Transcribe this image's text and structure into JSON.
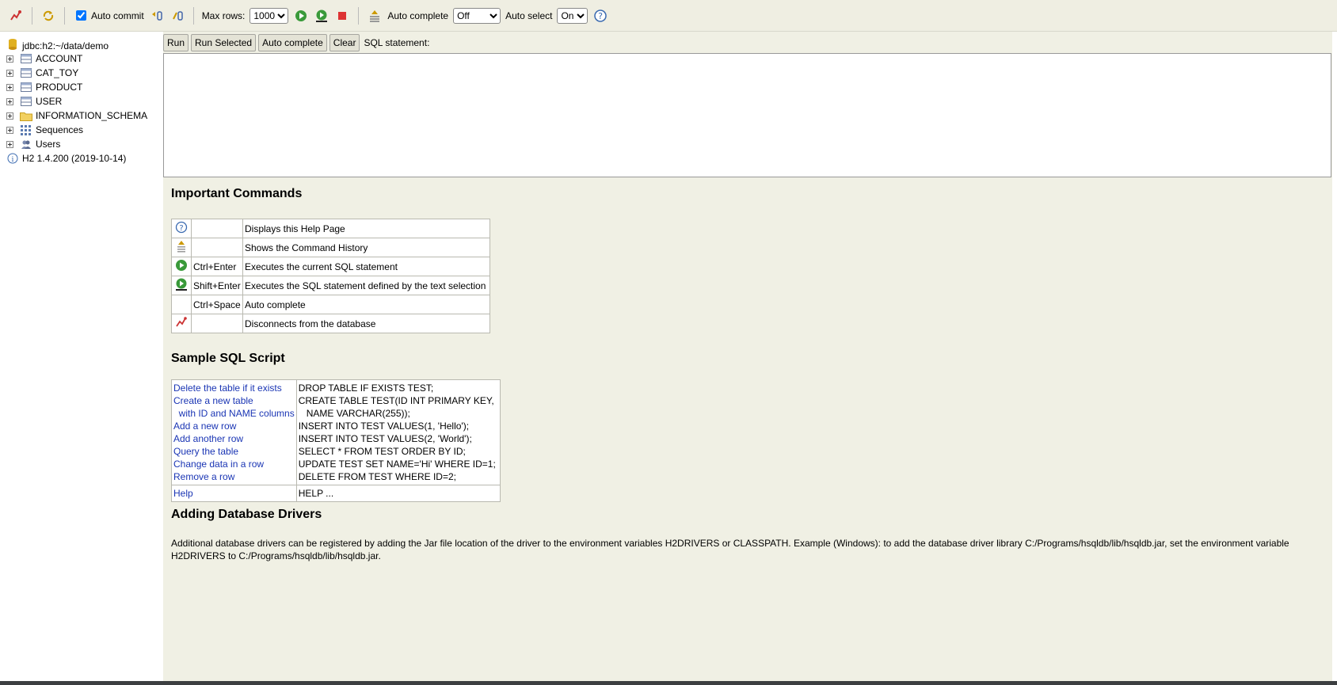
{
  "toolbar": {
    "auto_commit_label": "Auto commit",
    "max_rows_label": "Max rows:",
    "max_rows_value": "1000",
    "auto_complete_label": "Auto complete",
    "auto_complete_value": "Off",
    "auto_select_label": "Auto select",
    "auto_select_value": "On"
  },
  "sidebar": {
    "connection": "jdbc:h2:~/data/demo",
    "items": [
      {
        "label": "ACCOUNT",
        "icon": "table-icon"
      },
      {
        "label": "CAT_TOY",
        "icon": "table-icon"
      },
      {
        "label": "PRODUCT",
        "icon": "table-icon"
      },
      {
        "label": "USER",
        "icon": "table-icon"
      },
      {
        "label": "INFORMATION_SCHEMA",
        "icon": "folder-icon"
      },
      {
        "label": "Sequences",
        "icon": "sequences-icon"
      },
      {
        "label": "Users",
        "icon": "users-icon"
      }
    ],
    "version": "H2 1.4.200 (2019-10-14)"
  },
  "sql": {
    "run": "Run",
    "run_selected": "Run Selected",
    "auto_complete": "Auto complete",
    "clear": "Clear",
    "statement_label": "SQL statement:",
    "value": ""
  },
  "help": {
    "important_title": "Important Commands",
    "commands": [
      {
        "icon": "help-icon",
        "key": "",
        "desc": "Displays this Help Page"
      },
      {
        "icon": "history-icon",
        "key": "",
        "desc": "Shows the Command History"
      },
      {
        "icon": "run-icon",
        "key": "Ctrl+Enter",
        "desc": "Executes the current SQL statement"
      },
      {
        "icon": "run-selected-icon",
        "key": "Shift+Enter",
        "desc": "Executes the SQL statement defined by the text selection"
      },
      {
        "icon": "",
        "key": "Ctrl+Space",
        "desc": "Auto complete"
      },
      {
        "icon": "disconnect-icon",
        "key": "",
        "desc": "Disconnects from the database"
      }
    ],
    "sample_title": "Sample SQL Script",
    "sample_links": [
      "Delete the table if it exists",
      "Create a new table",
      "  with ID and NAME columns",
      "Add a new row",
      "Add another row",
      "Query the table",
      "Change data in a row",
      "Remove a row"
    ],
    "sample_code": [
      "DROP TABLE IF EXISTS TEST;",
      "CREATE TABLE TEST(ID INT PRIMARY KEY,",
      "   NAME VARCHAR(255));",
      "INSERT INTO TEST VALUES(1, 'Hello');",
      "INSERT INTO TEST VALUES(2, 'World');",
      "SELECT * FROM TEST ORDER BY ID;",
      "UPDATE TEST SET NAME='Hi' WHERE ID=1;",
      "DELETE FROM TEST WHERE ID=2;"
    ],
    "help_link": "Help",
    "help_code": "HELP ...",
    "drivers_title": "Adding Database Drivers",
    "drivers_text": "Additional database drivers can be registered by adding the Jar file location of the driver to the environment variables H2DRIVERS or CLASSPATH. Example (Windows): to add the database driver library C:/Programs/hsqldb/lib/hsqldb.jar, set the environment variable H2DRIVERS to C:/Programs/hsqldb/lib/hsqldb.jar."
  }
}
